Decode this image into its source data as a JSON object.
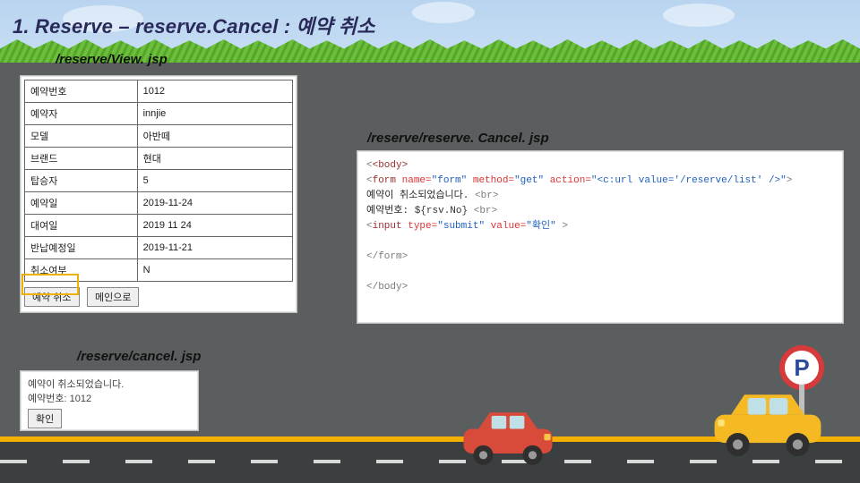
{
  "slide": {
    "title_prefix": "1. Reserve – ",
    "title_main": "reserve.Cancel : 예약 취소"
  },
  "captions": {
    "view": "/reserve/View. jsp",
    "code": "/reserve/reserve. Cancel. jsp",
    "cancel": "/reserve/cancel. jsp"
  },
  "view_table": {
    "rows": [
      {
        "label": "예약번호",
        "value": "1012"
      },
      {
        "label": "예약자",
        "value": "innjie"
      },
      {
        "label": "모델",
        "value": "아반떼"
      },
      {
        "label": "브랜드",
        "value": "현대"
      },
      {
        "label": "탑승자",
        "value": "5"
      },
      {
        "label": "예약일",
        "value": "2019-11-24"
      },
      {
        "label": "대여일",
        "value": "2019 11 24"
      },
      {
        "label": "반납예정일",
        "value": "2019-11-21"
      },
      {
        "label": "취소여부",
        "value": "N"
      }
    ],
    "btn_cancel": "예약 취소",
    "btn_back": "메인으로"
  },
  "code": {
    "l1a": "<body>",
    "l2_tag": "form",
    "l2_name_attr": "name",
    "l2_name_val": "\"form\"",
    "l2_method_attr": "method",
    "l2_method_val": "\"get\"",
    "l2_action_attr": "action",
    "l2_action_val": "\"<c:url value='/reserve/list' />\"",
    "l3_txt": "예약이 취소되었습니다.",
    "l3_br": "<br>",
    "l4_txt": "예약번호: ",
    "l4_expr": "${rsv.No}",
    "l4_br": "<br>",
    "l5_tag": "input",
    "l5_type_attr": "type",
    "l5_type_val": "\"submit\"",
    "l5_value_attr": "value",
    "l5_value_val": "\"확인\"",
    "l7": "</form>",
    "l9": "</body>"
  },
  "cancel_panel": {
    "line1": "예약이 취소되었습니다.",
    "line2_label": "예약번호: ",
    "line2_value": "1012",
    "btn": "확인"
  },
  "icons": {
    "parking_letter": "P"
  },
  "colors": {
    "accent_yellow": "#f4b000",
    "sign_red": "#d73a3a",
    "sign_blue": "#2d4b9b"
  }
}
